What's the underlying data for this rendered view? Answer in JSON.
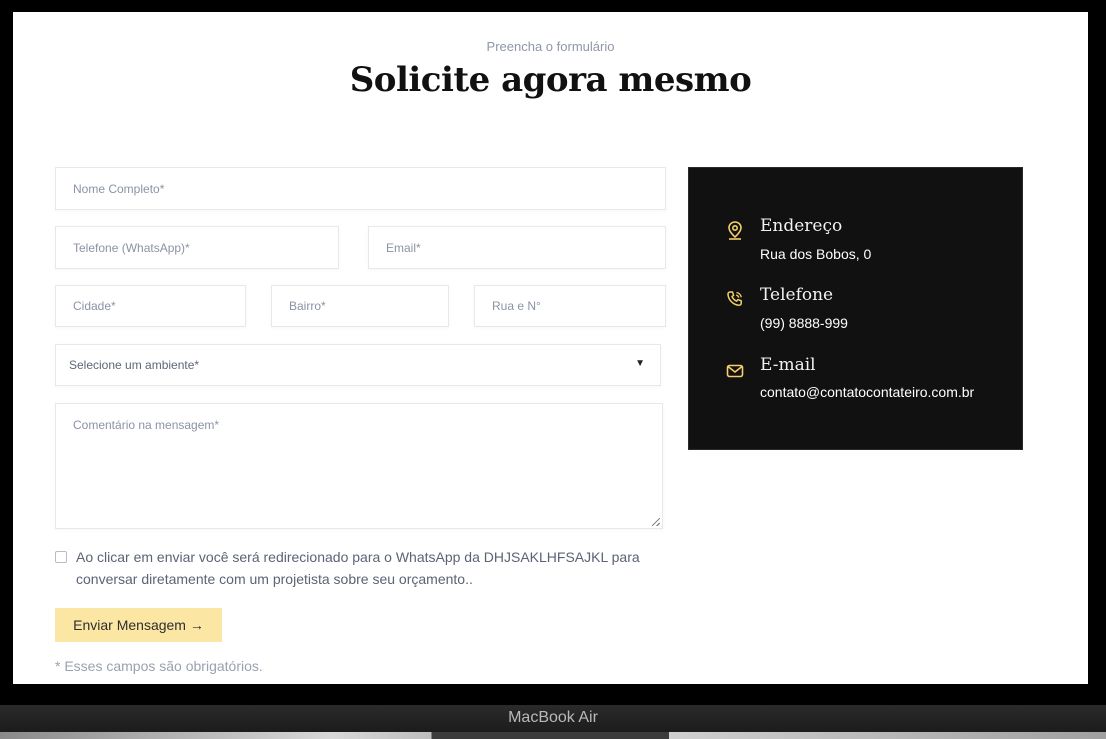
{
  "header": {
    "subtitle": "Preencha o formulário",
    "title": "Solicite agora mesmo"
  },
  "form": {
    "name_placeholder": "Nome Completo*",
    "phone_placeholder": "Telefone (WhatsApp)*",
    "email_placeholder": "Email*",
    "city_placeholder": "Cidade*",
    "district_placeholder": "Bairro*",
    "street_placeholder": "Rua e N°",
    "environment_select": {
      "selected": "Selecione um ambiente*",
      "caret": "▼"
    },
    "comment_placeholder": "Comentário na mensagem*",
    "consent_text": "Ao clicar em enviar você será redirecionado para o WhatsApp da DHJSAKLHFSAJKL para conversar diretamente com um projetista sobre seu orçamento..",
    "consent_checked": false,
    "submit_label": "Enviar Mensagem →",
    "required_note": "* Esses campos são obrigatórios."
  },
  "contact": {
    "address": {
      "label": "Endereço",
      "value": "Rua dos Bobos, 0",
      "icon": "location-pin-icon"
    },
    "phone": {
      "label": "Telefone",
      "value": "(99) 8888-999",
      "icon": "phone-icon"
    },
    "email": {
      "label": "E-mail",
      "value": "contato@contatocontateiro.com.br",
      "icon": "mail-icon"
    }
  },
  "device": {
    "label": "MacBook Air"
  },
  "colors": {
    "accent": "#fbe6a3",
    "icon_gold": "#f5cf6b",
    "card_bg": "#111111"
  }
}
